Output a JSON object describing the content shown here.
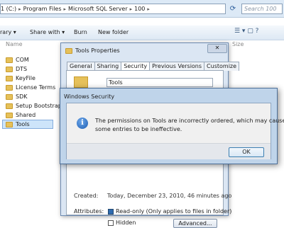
{
  "explorer": {
    "address_parts": [
      "1 (C:)",
      "Program Files",
      "Microsoft SQL Server",
      "100"
    ],
    "search_placeholder": "Search 100",
    "toolbar": {
      "organize_label": "rary",
      "share_label": "Share with",
      "burn_label": "Burn",
      "newfolder_label": "New folder"
    },
    "col_name": "Name",
    "col_size": "Size",
    "nav_items": [
      "COM",
      "DTS",
      "KeyFile",
      "License Terms",
      "SDK",
      "Setup Bootstrap",
      "Shared",
      "Tools"
    ],
    "selected_item": "Tools"
  },
  "properties": {
    "title": "Tools Properties",
    "close_label": "✕",
    "tabs": [
      "General",
      "Sharing",
      "Security",
      "Previous Versions",
      "Customize"
    ],
    "active_tab": "Security",
    "name_value": "Tools",
    "created_label": "Created:",
    "created_value": "Today, December 23, 2010, 46 minutes ago",
    "attributes_label": "Attributes:",
    "readonly_label": "Read-only (Only applies to files in folder)",
    "hidden_label": "Hidden",
    "advanced_label": "Advanced..."
  },
  "security_dialog": {
    "title": "Windows Security",
    "message_line1": "The permissions on Tools are incorrectly ordered, which may cause",
    "message_line2": "some entries to be ineffective.",
    "ok_label": "OK",
    "icon": "info-icon"
  }
}
